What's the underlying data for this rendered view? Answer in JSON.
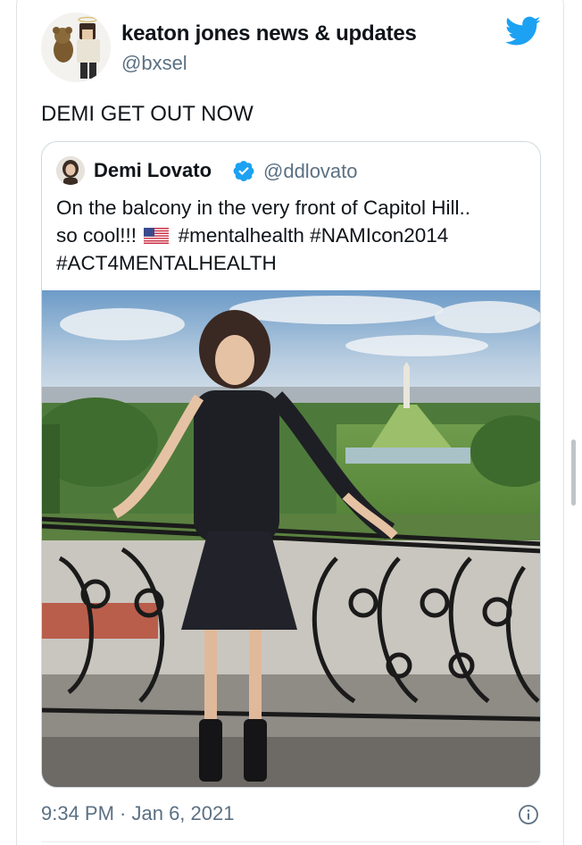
{
  "tweet": {
    "display_name": "keaton jones news & updates",
    "handle": "@bxsel",
    "text": "DEMI GET OUT NOW",
    "timestamp": "9:34 PM · Jan 6, 2021",
    "icons": {
      "brand": "twitter-bird-icon",
      "info": "info-icon",
      "avatar": "user-avatar"
    }
  },
  "quoted_tweet": {
    "display_name": "Demi Lovato",
    "handle": "@ddlovato",
    "verified": true,
    "text_line1": "On the balcony in the very front of Capitol Hill..",
    "text_line2_start": "so cool!!!",
    "text_line2_end": "#mentalhealth #NAMIcon2014",
    "text_line3": "#ACT4MENTALHEALTH",
    "icons": {
      "verified": "verified-badge-icon",
      "flag": "us-flag-emoji"
    }
  },
  "colors": {
    "twitter_blue": "#1da1f2",
    "text_primary": "#0f1419",
    "text_secondary": "#5b7083",
    "border": "#cfd9de"
  }
}
